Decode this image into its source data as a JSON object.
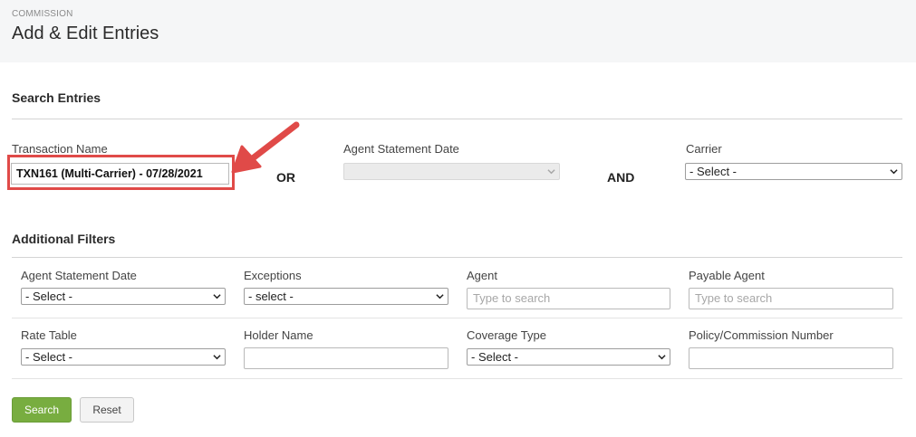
{
  "header": {
    "breadcrumb": "COMMISSION",
    "title": "Add & Edit Entries"
  },
  "search_entries": {
    "title": "Search Entries",
    "transaction_name": {
      "label": "Transaction Name",
      "value": "TXN161 (Multi-Carrier) - 07/28/2021"
    },
    "or_label": "OR",
    "agent_statement_date": {
      "label": "Agent Statement Date",
      "value": ""
    },
    "and_label": "AND",
    "carrier": {
      "label": "Carrier",
      "value": "- Select -"
    }
  },
  "additional_filters": {
    "title": "Additional Filters",
    "agent_statement_date": {
      "label": "Agent Statement Date",
      "value": "- Select -"
    },
    "exceptions": {
      "label": "Exceptions",
      "value": "- select -"
    },
    "agent": {
      "label": "Agent",
      "placeholder": "Type to search"
    },
    "payable_agent": {
      "label": "Payable Agent",
      "placeholder": "Type to search"
    },
    "rate_table": {
      "label": "Rate Table",
      "value": "- Select -"
    },
    "holder_name": {
      "label": "Holder Name",
      "value": ""
    },
    "coverage_type": {
      "label": "Coverage Type",
      "value": "- Select -"
    },
    "policy_commission_number": {
      "label": "Policy/Commission Number",
      "value": ""
    }
  },
  "actions": {
    "search_label": "Search",
    "reset_label": "Reset"
  },
  "colors": {
    "highlight": "#e04a48",
    "search_button": "#78ad40",
    "header_bg": "#f5f6f7"
  }
}
